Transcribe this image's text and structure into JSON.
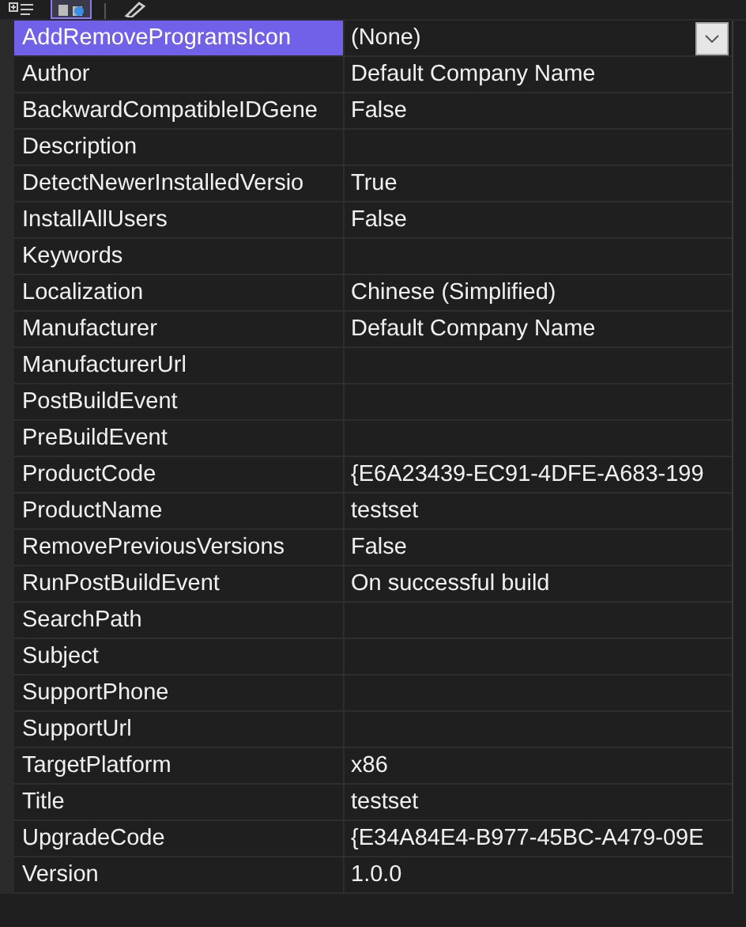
{
  "toolbar": [
    {
      "kind": "categorized",
      "selected": false
    },
    {
      "kind": "alphabetical",
      "selected": true
    },
    {
      "kind": "pages",
      "selected": false
    }
  ],
  "properties": [
    {
      "name": "AddRemoveProgramsIcon",
      "value": "(None)",
      "selected": true,
      "dropdown": true
    },
    {
      "name": "Author",
      "value": "Default Company Name",
      "selected": false
    },
    {
      "name": "BackwardCompatibleIDGene",
      "value": "False",
      "selected": false
    },
    {
      "name": "Description",
      "selected": false
    },
    {
      "name": "DetectNewerInstalledVersio",
      "value": "True",
      "selected": false
    },
    {
      "name": "InstallAllUsers",
      "value": "False",
      "selected": false
    },
    {
      "name": "Keywords",
      "selected": false
    },
    {
      "name": "Localization",
      "value": "Chinese (Simplified)",
      "selected": false
    },
    {
      "name": "Manufacturer",
      "value": "Default Company Name",
      "selected": false
    },
    {
      "name": "ManufacturerUrl",
      "selected": false
    },
    {
      "name": "PostBuildEvent",
      "selected": false
    },
    {
      "name": "PreBuildEvent",
      "selected": false
    },
    {
      "name": "ProductCode",
      "value": "{E6A23439-EC91-4DFE-A683-199",
      "selected": false
    },
    {
      "name": "ProductName",
      "value": "testset",
      "selected": false
    },
    {
      "name": "RemovePreviousVersions",
      "value": "False",
      "selected": false
    },
    {
      "name": "RunPostBuildEvent",
      "value": "On successful build",
      "selected": false
    },
    {
      "name": "SearchPath",
      "selected": false
    },
    {
      "name": "Subject",
      "selected": false
    },
    {
      "name": "SupportPhone",
      "selected": false
    },
    {
      "name": "SupportUrl",
      "selected": false
    },
    {
      "name": "TargetPlatform",
      "value": "x86",
      "selected": false
    },
    {
      "name": "Title",
      "value": "testset",
      "selected": false
    },
    {
      "name": "UpgradeCode",
      "value": "{E34A84E4-B977-45BC-A479-09E",
      "selected": false
    },
    {
      "name": "Version",
      "value": "1.0.0",
      "selected": false
    }
  ]
}
